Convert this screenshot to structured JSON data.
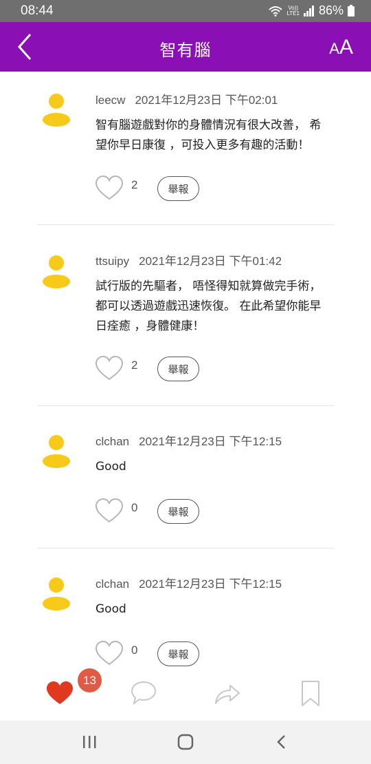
{
  "status": {
    "time": "08:44",
    "volte_top": "Vo))",
    "volte_bottom": "LTE1",
    "battery": "86%"
  },
  "header": {
    "title": "智有腦",
    "font_size_small": "A",
    "font_size_large": "A"
  },
  "comments": [
    {
      "user": "leecw",
      "timestamp": "2021年12月23日 下午02:01",
      "text": "智有腦遊戲對你的身體情況有很大改善， 希望你早日康復 ，可投入更多有趣的活動！",
      "likes": "2",
      "report_label": "舉報"
    },
    {
      "user": "ttsuipy",
      "timestamp": "2021年12月23日 下午01:42",
      "text": "試行版的先驅者， 唔怪得知就算做完手術， 都可以透過遊戲迅速恢復。 在此希望你能早日痊癒 ，身體健康！",
      "likes": "2",
      "report_label": "舉報"
    },
    {
      "user": "clchan",
      "timestamp": "2021年12月23日 下午12:15",
      "text": "Good",
      "likes": "0",
      "report_label": "舉報"
    },
    {
      "user": "clchan",
      "timestamp": "2021年12月23日 下午12:15",
      "text": "Good",
      "likes": "0",
      "report_label": "舉報"
    }
  ],
  "action_bar": {
    "like_badge_count": "13"
  },
  "colors": {
    "header_bg": "#8a0fb5",
    "heart_active": "#e0391f",
    "badge_bg": "#e05a46",
    "avatar": "#f7c918",
    "icon_gray": "#c8c8c8"
  },
  "icons": [
    "wifi-icon",
    "signal-icon",
    "battery-icon",
    "back-arrow-icon",
    "font-size-icon",
    "avatar-icon",
    "heart-outline-icon",
    "heart-filled-icon",
    "comment-icon",
    "share-icon",
    "bookmark-icon",
    "recent-apps-icon",
    "home-icon",
    "nav-back-icon"
  ]
}
